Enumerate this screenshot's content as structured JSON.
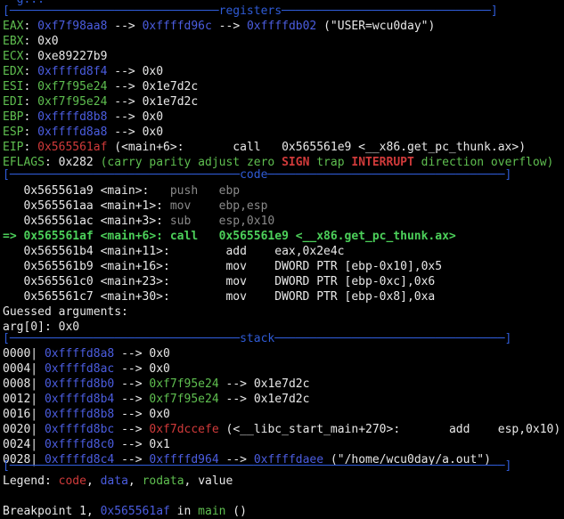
{
  "top_partial": "──g...",
  "sections": {
    "registers": "[──────────────────────────────registers──────────────────────────────]",
    "code": "[─────────────────────────────────code──────────────────────────────────]",
    "stack": "[─────────────────────────────────stack─────────────────────────────────]",
    "end": "[───────────────────────────────────────────────────────────────────────]"
  },
  "registers": {
    "eax": {
      "name": "EAX",
      "sep": ": ",
      "v1": "0xf7f98aa8",
      "arrow1": " --> ",
      "v2": "0xffffd96c",
      "arrow2": " --> ",
      "v3": "0xffffdb02",
      "tail": " (\"USER=wcu0day\")"
    },
    "ebx": {
      "name": "EBX",
      "sep": ": ",
      "v1": "0x0"
    },
    "ecx": {
      "name": "ECX",
      "sep": ": ",
      "v1": "0xe89227b9"
    },
    "edx": {
      "name": "EDX",
      "sep": ": ",
      "v1": "0xffffd8f4",
      "arrow1": " --> ",
      "v2": "0x0"
    },
    "esi": {
      "name": "ESI",
      "sep": ": ",
      "v1": "0xf7f95e24",
      "arrow1": " --> ",
      "v2": "0x1e7d2c"
    },
    "edi": {
      "name": "EDI",
      "sep": ": ",
      "v1": "0xf7f95e24",
      "arrow1": " --> ",
      "v2": "0x1e7d2c"
    },
    "ebp": {
      "name": "EBP",
      "sep": ": ",
      "v1": "0xffffd8b8",
      "arrow1": " --> ",
      "v2": "0x0"
    },
    "esp": {
      "name": "ESP",
      "sep": ": ",
      "v1": "0xffffd8a8",
      "arrow1": " --> ",
      "v2": "0x0"
    },
    "eip": {
      "name": "EIP",
      "sep": ": ",
      "v1": "0x565561af",
      "tail": " (<main+6>:       call   0x565561e9 <__x86.get_pc_thunk.ax>)"
    },
    "eflags": {
      "name": "EFLAGS",
      "val": ": 0x282 ",
      "open": "(",
      "f1": "carry parity adjust zero ",
      "f2": "SIGN",
      "f3": " trap ",
      "f4": "INTERRUPT",
      "f5": " direction overflow",
      "close": ")"
    }
  },
  "code": [
    {
      "addr": "   0x565561a9 <main>:   ",
      "ins": "push   ebp"
    },
    {
      "addr": "   0x565561aa <main+1>: ",
      "ins": "mov    ebp,esp"
    },
    {
      "addr": "   0x565561ac <main+3>: ",
      "ins": "sub    esp,0x10"
    },
    {
      "current": "=> 0x565561af <main+6>: call   0x565561e9 <__x86.get_pc_thunk.ax>"
    },
    {
      "line": "   0x565561b4 <main+11>:        add    eax,0x2e4c"
    },
    {
      "line": "   0x565561b9 <main+16>:        mov    DWORD PTR [ebp-0x10],0x5"
    },
    {
      "line": "   0x565561c0 <main+23>:        mov    DWORD PTR [ebp-0xc],0x6"
    },
    {
      "line": "   0x565561c7 <main+30>:        mov    DWORD PTR [ebp-0x8],0xa"
    }
  ],
  "guessed": {
    "title": "Guessed arguments:",
    "arg0": "arg[0]: 0x0"
  },
  "stack": [
    {
      "off": "0000| ",
      "a": "0xffffd8a8",
      "r1": " --> ",
      "v1": "0x0"
    },
    {
      "off": "0004| ",
      "a": "0xffffd8ac",
      "r1": " --> ",
      "v1": "0x0"
    },
    {
      "off": "0008| ",
      "a": "0xffffd8b0",
      "r1": " --> ",
      "v1": "0xf7f95e24",
      "r2": " --> ",
      "v2": "0x1e7d2c"
    },
    {
      "off": "0012| ",
      "a": "0xffffd8b4",
      "r1": " --> ",
      "v1": "0xf7f95e24",
      "r2": " --> ",
      "v2": "0x1e7d2c"
    },
    {
      "off": "0016| ",
      "a": "0xffffd8b8",
      "r1": " --> ",
      "v1": "0x0"
    },
    {
      "off": "0020| ",
      "a": "0xffffd8bc",
      "r1": " --> ",
      "v1": "0xf7dccefe",
      "r2": " (<__libc_start_main+270>:       add    esp,0x10)"
    },
    {
      "off": "0024| ",
      "a": "0xffffd8c0",
      "r1": " --> ",
      "v1": "0x1"
    },
    {
      "off": "0028| ",
      "a": "0xffffd8c4",
      "r1": " --> ",
      "v1": "0xffffd964",
      "r2": " --> ",
      "v2": "0xffffdaee",
      "r3": " (\"/home/wcu0day/a.out\")"
    }
  ],
  "legend": {
    "label": "Legend: ",
    "code": "code",
    "c1": ", ",
    "data": "data",
    "c2": ", ",
    "rodata": "rodata",
    "c3": ", ",
    "value": "value"
  },
  "breakpoint": {
    "pre": "Breakpoint 1, ",
    "addr": "0x565561af",
    "mid": " in ",
    "fn": "main",
    "post": " ()"
  },
  "colors": {
    "green": "#5fbf50",
    "blue": "#4b5de0",
    "red": "#d03a3a",
    "separator": "#2f5bd6"
  }
}
